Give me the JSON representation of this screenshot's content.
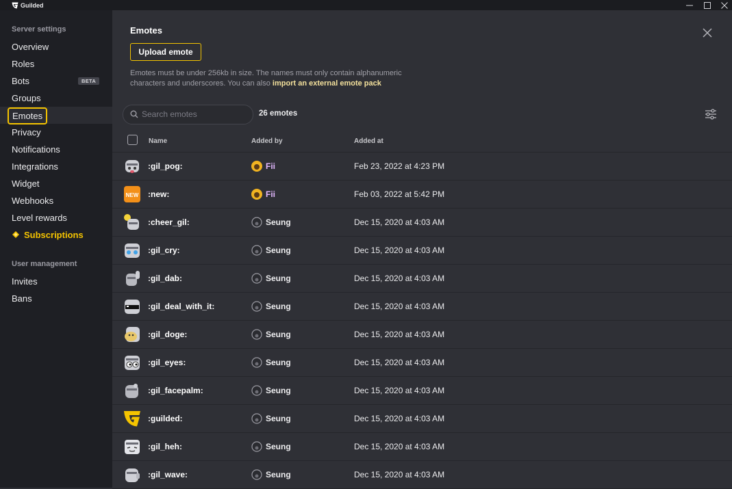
{
  "app": {
    "name": "Guilded"
  },
  "sidebar": {
    "section1": "Server settings",
    "items": [
      {
        "label": "Overview"
      },
      {
        "label": "Roles"
      },
      {
        "label": "Bots",
        "badge": "BETA"
      },
      {
        "label": "Groups"
      },
      {
        "label": "Emotes",
        "selected": true
      },
      {
        "label": "Privacy"
      },
      {
        "label": "Notifications"
      },
      {
        "label": "Integrations"
      },
      {
        "label": "Widget"
      },
      {
        "label": "Webhooks"
      },
      {
        "label": "Level rewards"
      },
      {
        "label": "Subscriptions",
        "icon": "diamond-icon"
      }
    ],
    "section2": "User management",
    "items2": [
      {
        "label": "Invites"
      },
      {
        "label": "Bans"
      }
    ]
  },
  "main": {
    "title": "Emotes",
    "upload_label": "Upload emote",
    "info_text": "Emotes must be under 256kb in size. The names must only contain alphanumeric characters and underscores. You can also",
    "info_link": "import an external emote pack",
    "search_placeholder": "Search emotes",
    "count": "26 emotes",
    "columns": {
      "name": "Name",
      "added_by": "Added by",
      "added_at": "Added at"
    },
    "rows": [
      {
        "name": ":gil_pog:",
        "user": "Fii",
        "date": "Feb 23, 2022 at 4:23 PM",
        "icon": "gil-pog-icon"
      },
      {
        "name": ":new:",
        "user": "Fii",
        "date": "Feb 03, 2022 at 5:42 PM",
        "icon": "new-badge-icon"
      },
      {
        "name": ":cheer_gil:",
        "user": "Seung",
        "date": "Dec 15, 2020 at 4:03 AM",
        "icon": "cheer-gil-icon"
      },
      {
        "name": ":gil_cry:",
        "user": "Seung",
        "date": "Dec 15, 2020 at 4:03 AM",
        "icon": "gil-cry-icon"
      },
      {
        "name": ":gil_dab:",
        "user": "Seung",
        "date": "Dec 15, 2020 at 4:03 AM",
        "icon": "gil-dab-icon"
      },
      {
        "name": ":gil_deal_with_it:",
        "user": "Seung",
        "date": "Dec 15, 2020 at 4:03 AM",
        "icon": "gil-deal-with-it-icon"
      },
      {
        "name": ":gil_doge:",
        "user": "Seung",
        "date": "Dec 15, 2020 at 4:03 AM",
        "icon": "gil-doge-icon"
      },
      {
        "name": ":gil_eyes:",
        "user": "Seung",
        "date": "Dec 15, 2020 at 4:03 AM",
        "icon": "gil-eyes-icon"
      },
      {
        "name": ":gil_facepalm:",
        "user": "Seung",
        "date": "Dec 15, 2020 at 4:03 AM",
        "icon": "gil-facepalm-icon"
      },
      {
        "name": ":guilded:",
        "user": "Seung",
        "date": "Dec 15, 2020 at 4:03 AM",
        "icon": "guilded-logo-icon"
      },
      {
        "name": ":gil_heh:",
        "user": "Seung",
        "date": "Dec 15, 2020 at 4:03 AM",
        "icon": "gil-heh-icon"
      },
      {
        "name": ":gil_wave:",
        "user": "Seung",
        "date": "Dec 15, 2020 at 4:03 AM",
        "icon": "gil-wave-icon"
      }
    ]
  },
  "colors": {
    "accent": "#f5c400",
    "sidebar_bg": "#1e1f24",
    "main_bg": "#2f3036",
    "titlebar_bg": "#1b1c20"
  }
}
